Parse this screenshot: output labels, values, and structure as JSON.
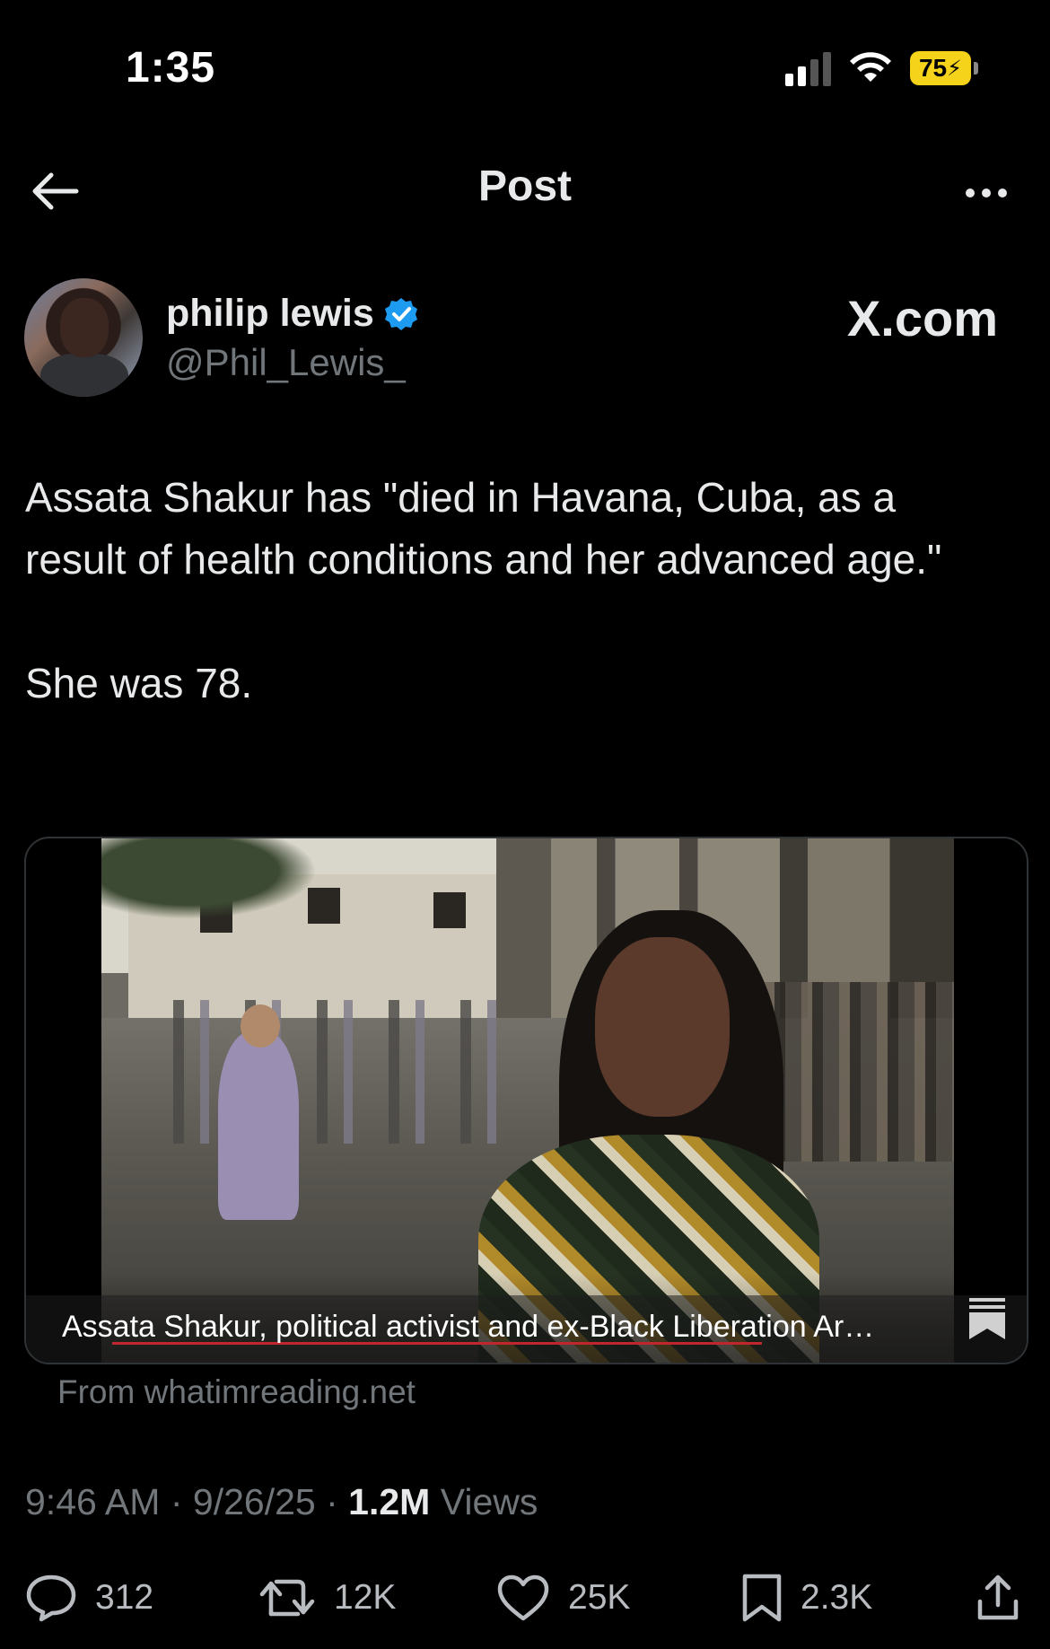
{
  "status_bar": {
    "time": "1:35",
    "battery": "75"
  },
  "nav": {
    "title": "Post"
  },
  "author": {
    "name": "philip lewis",
    "handle": "@Phil_Lewis_"
  },
  "brand": "X.com",
  "post": {
    "paragraph1": "Assata Shakur has \"died in Havana, Cuba, as a result of health conditions and her advanced age.\"",
    "paragraph2": "She was 78."
  },
  "media": {
    "caption": "Assata Shakur, political activist and ex-Black Liberation Ar…"
  },
  "source": "From whatimreading.net",
  "meta": {
    "time": "9:46 AM",
    "separator": "·",
    "date": "9/26/25",
    "views_count": "1.2M",
    "views_label": "Views"
  },
  "actions": {
    "replies": "312",
    "reposts": "12K",
    "likes": "25K",
    "bookmarks": "2.3K"
  },
  "colors": {
    "background": "#000000",
    "text": "#e7e9ea",
    "secondary": "#71767b",
    "verified": "#1d9bf0",
    "battery": "#f5d31a"
  },
  "icons": [
    "signal-icon",
    "wifi-icon",
    "battery-icon",
    "back-arrow-icon",
    "more-icon",
    "verified-badge-icon",
    "bookmark-icon",
    "reply-icon",
    "repost-icon",
    "like-icon",
    "share-icon"
  ]
}
